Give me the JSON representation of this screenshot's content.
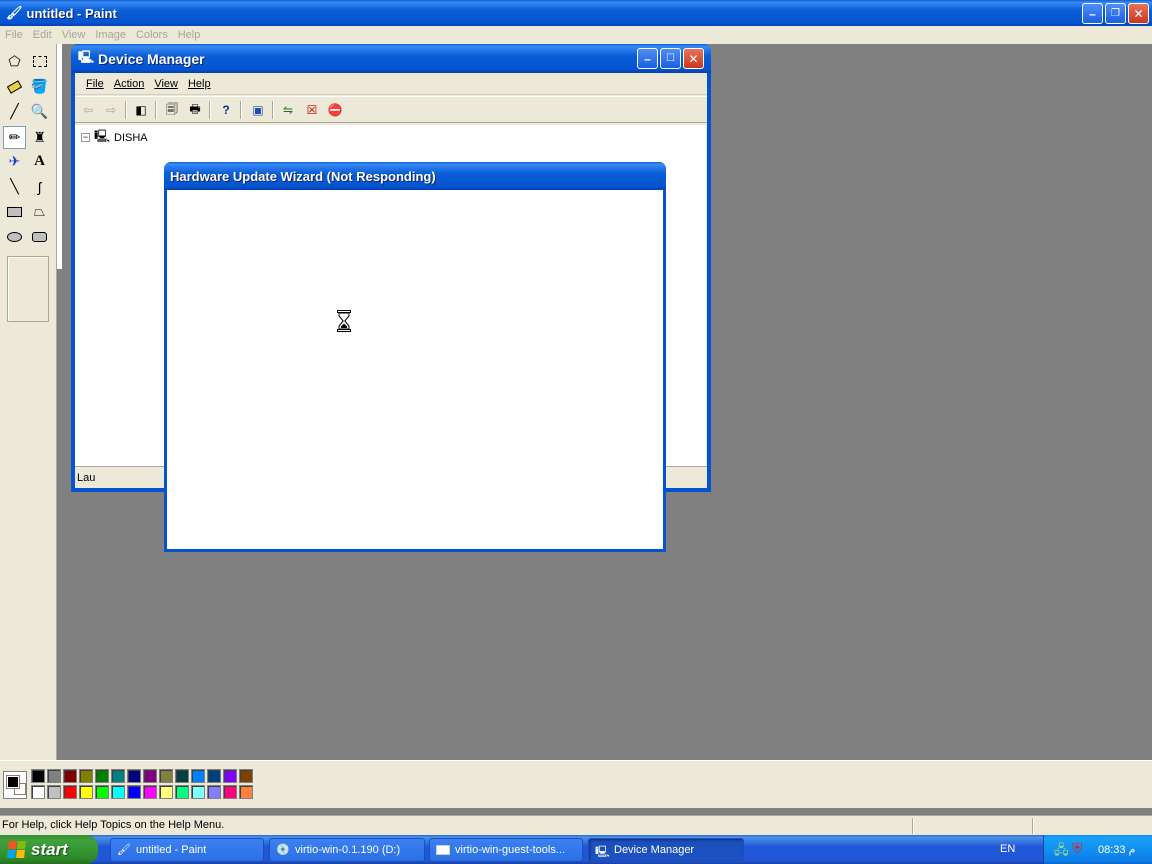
{
  "paint": {
    "title": "untitled - Paint",
    "menu": [
      "File",
      "Edit",
      "View",
      "Image",
      "Colors",
      "Help"
    ],
    "status_text": "For Help, click Help Topics on the Help Menu.",
    "palette_row1": [
      "#000000",
      "#808080",
      "#800000",
      "#808000",
      "#008000",
      "#008080",
      "#000080",
      "#800080",
      "#808040",
      "#004040",
      "#0080ff",
      "#004080",
      "#8000ff",
      "#804000"
    ],
    "palette_row2": [
      "#ffffff",
      "#c0c0c0",
      "#ff0000",
      "#ffff00",
      "#00ff00",
      "#00ffff",
      "#0000ff",
      "#ff00ff",
      "#ffff80",
      "#00ff80",
      "#80ffff",
      "#8080ff",
      "#ff0080",
      "#ff8040"
    ]
  },
  "device_manager": {
    "title": "Device Manager",
    "menu": {
      "file": "File",
      "action": "Action",
      "view": "View",
      "help": "Help"
    },
    "tree_root": "DISHA",
    "status_text": "Lau"
  },
  "hardware_wizard": {
    "title": "Hardware Update Wizard (Not Responding)"
  },
  "taskbar": {
    "start_label": "start",
    "tasks": [
      {
        "label": "untitled - Paint",
        "icon": "paint-icon"
      },
      {
        "label": "virtio-win-0.1.190 (D:)",
        "icon": "cd-drive-icon"
      },
      {
        "label": "virtio-win-guest-tools...",
        "icon": "window-icon"
      },
      {
        "label": "Device Manager",
        "icon": "device-manager-icon"
      }
    ],
    "language": "EN",
    "clock": "08:33 م"
  }
}
